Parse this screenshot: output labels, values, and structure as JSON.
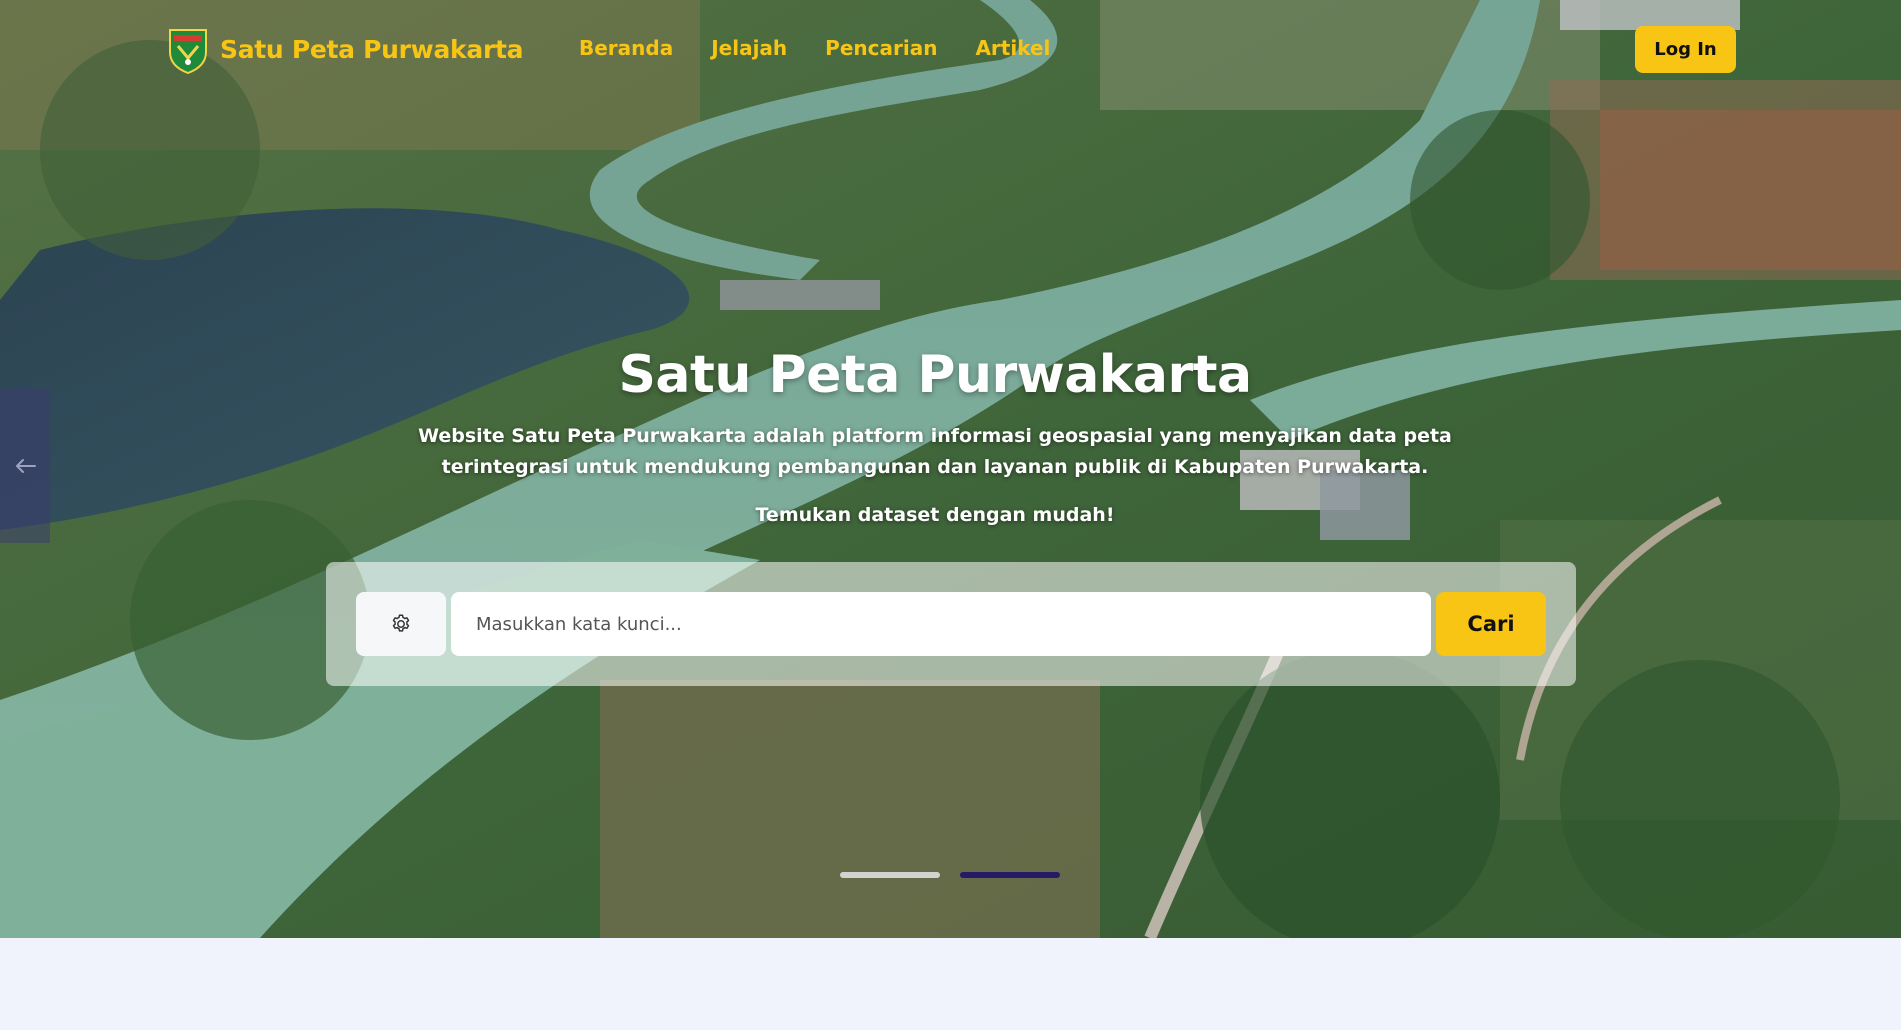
{
  "brand": {
    "name": "Satu Peta Purwakarta",
    "logo_icon": "purwakarta-emblem-icon"
  },
  "nav": {
    "items": [
      {
        "label": "Beranda"
      },
      {
        "label": "Jelajah"
      },
      {
        "label": "Pencarian"
      },
      {
        "label": "Artikel"
      }
    ],
    "login_label": "Log In"
  },
  "hero": {
    "title": "Satu Peta Purwakarta",
    "description": "Website Satu Peta Purwakarta adalah platform informasi geospasial yang menyajikan data peta terintegrasi untuk mendukung pembangunan dan layanan publik di Kabupaten Purwakarta.",
    "subtitle": "Temukan dataset dengan mudah!",
    "background": "aerial-river-landscape"
  },
  "search": {
    "filter_icon": "settings-gear-icon",
    "placeholder": "Masukkan kata kunci...",
    "value": "",
    "button_label": "Cari"
  },
  "carousel": {
    "prev_icon": "arrow-left-icon",
    "slide_count": 2,
    "active_index": 1
  },
  "colors": {
    "accent": "#f9c514",
    "indicator_active": "#241a66",
    "page_background": "#f0f3fb"
  }
}
